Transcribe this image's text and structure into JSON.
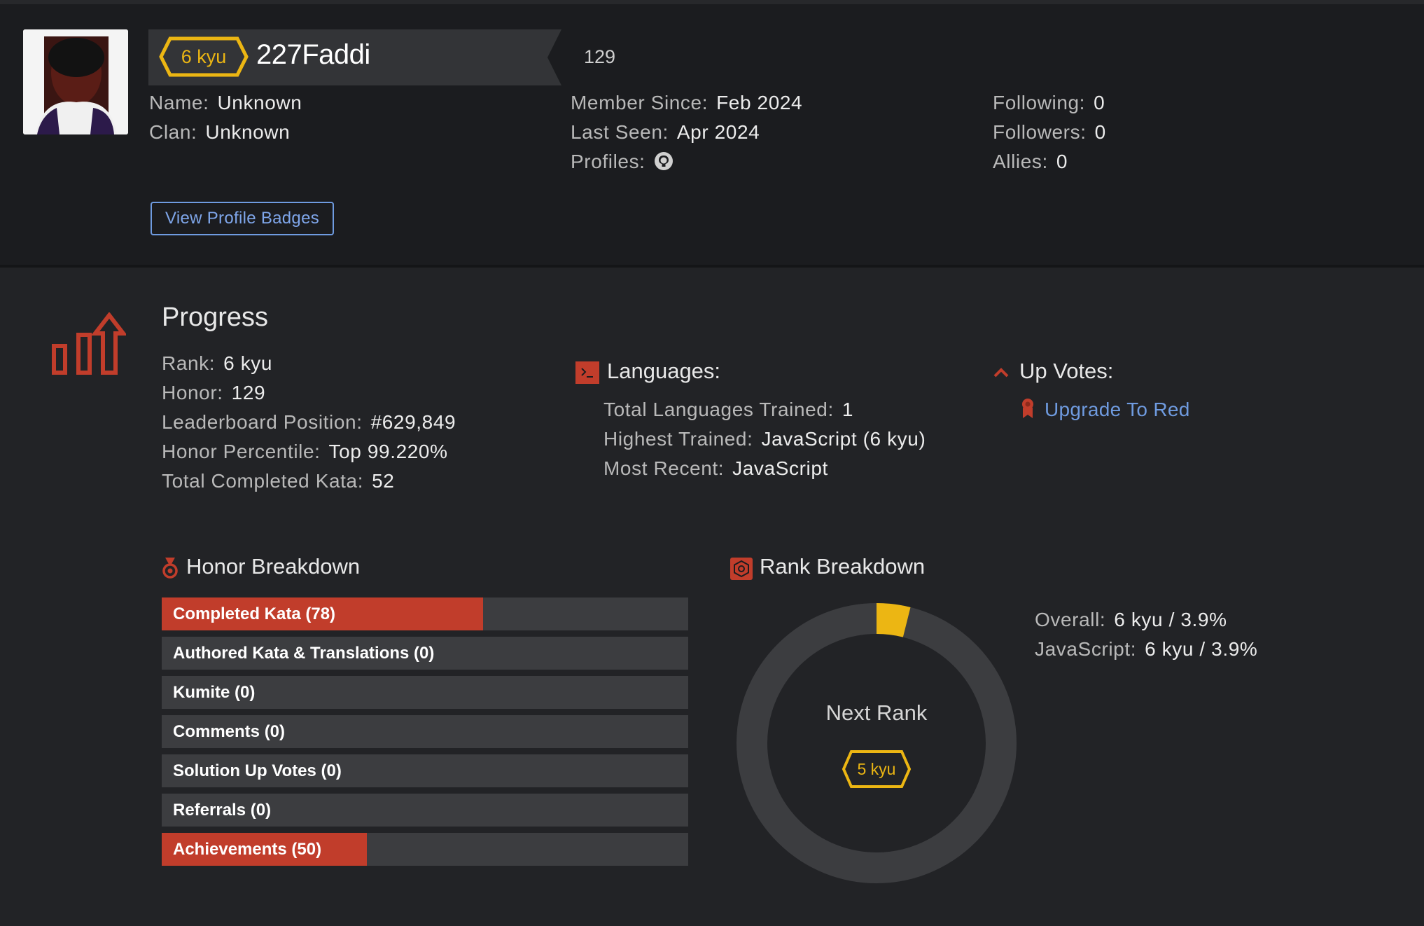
{
  "header": {
    "rank_badge": "6 kyu",
    "username": "227Faddi",
    "honor": "129",
    "name_label": "Name:",
    "name_value": "Unknown",
    "clan_label": "Clan:",
    "clan_value": "Unknown",
    "member_since_label": "Member Since:",
    "member_since_value": "Feb 2024",
    "last_seen_label": "Last Seen:",
    "last_seen_value": "Apr 2024",
    "profiles_label": "Profiles:",
    "following_label": "Following:",
    "following_value": "0",
    "followers_label": "Followers:",
    "followers_value": "0",
    "allies_label": "Allies:",
    "allies_value": "0",
    "view_badges_button": "View Profile Badges"
  },
  "progress": {
    "title": "Progress",
    "rank_label": "Rank:",
    "rank_value": "6 kyu",
    "honor_label": "Honor:",
    "honor_value": "129",
    "leaderboard_label": "Leaderboard Position:",
    "leaderboard_value": "#629,849",
    "percentile_label": "Honor Percentile:",
    "percentile_value": "Top 99.220%",
    "completed_label": "Total Completed Kata:",
    "completed_value": "52"
  },
  "languages": {
    "title": "Languages:",
    "total_label": "Total Languages Trained:",
    "total_value": "1",
    "highest_label": "Highest Trained:",
    "highest_value": "JavaScript (6 kyu)",
    "recent_label": "Most Recent:",
    "recent_value": "JavaScript"
  },
  "upvotes": {
    "title": "Up Votes:",
    "upgrade_link": "Upgrade To Red"
  },
  "honor_breakdown": {
    "title": "Honor Breakdown",
    "bars": [
      {
        "label": "Completed Kata (78)",
        "fill": 0.61
      },
      {
        "label": "Authored Kata & Translations (0)",
        "fill": 0
      },
      {
        "label": "Kumite (0)",
        "fill": 0
      },
      {
        "label": "Comments (0)",
        "fill": 0
      },
      {
        "label": "Solution Up Votes (0)",
        "fill": 0
      },
      {
        "label": "Referrals (0)",
        "fill": 0
      },
      {
        "label": "Achievements (50)",
        "fill": 0.39
      }
    ]
  },
  "rank_breakdown": {
    "title": "Rank Breakdown",
    "progress_fraction": 0.039,
    "next_rank_label": "Next Rank",
    "next_rank_badge": "5 kyu",
    "overall_label": "Overall:",
    "overall_value": "6 kyu / 3.9%",
    "js_label": "JavaScript:",
    "js_value": "6 kyu / 3.9%"
  },
  "colors": {
    "accent_red": "#c13d2b",
    "rank_yellow": "#ecb613",
    "link_blue": "#6f9be0"
  },
  "icons": {
    "github": "github-icon",
    "progress": "bar-chart-up-icon",
    "languages": "terminal-icon",
    "upvotes": "chevron-up-icon",
    "ribbon": "ribbon-icon",
    "medal": "medal-icon",
    "rank": "hexagon-target-icon"
  }
}
